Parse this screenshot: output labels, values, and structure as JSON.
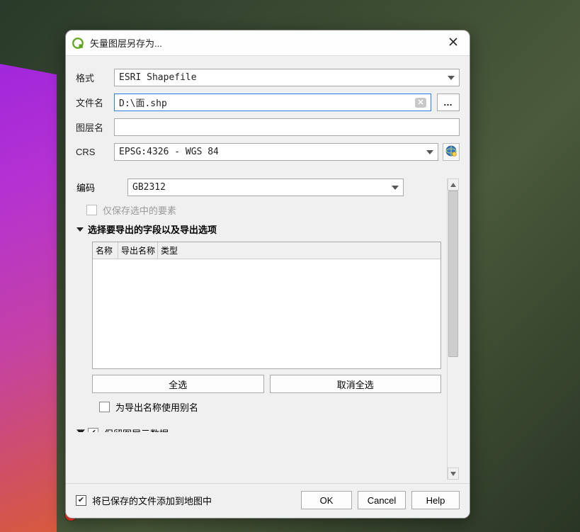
{
  "window": {
    "title": "矢量图层另存为..."
  },
  "form": {
    "format_label": "格式",
    "format_value": "ESRI Shapefile",
    "filename_label": "文件名",
    "filename_value": "D:\\面.shp",
    "browse_label": "…",
    "layername_label": "图层名",
    "layername_value": "",
    "crs_label": "CRS",
    "crs_value": "EPSG:4326 - WGS 84"
  },
  "encoding": {
    "label": "编码",
    "value": "GB2312"
  },
  "options": {
    "only_selected_label": "仅保存选中的要素",
    "fields_section_label": "选择要导出的字段以及导出选项",
    "columns": {
      "name": "名称",
      "export_name": "导出名称",
      "type": "类型"
    },
    "select_all": "全选",
    "deselect_all": "取消全选",
    "use_alias_label": "为导出名称使用别名",
    "keep_metadata_label": "保留图层元数据"
  },
  "footer": {
    "add_to_map_label": "将已保存的文件添加到地图中",
    "ok": "OK",
    "cancel": "Cancel",
    "help": "Help"
  }
}
